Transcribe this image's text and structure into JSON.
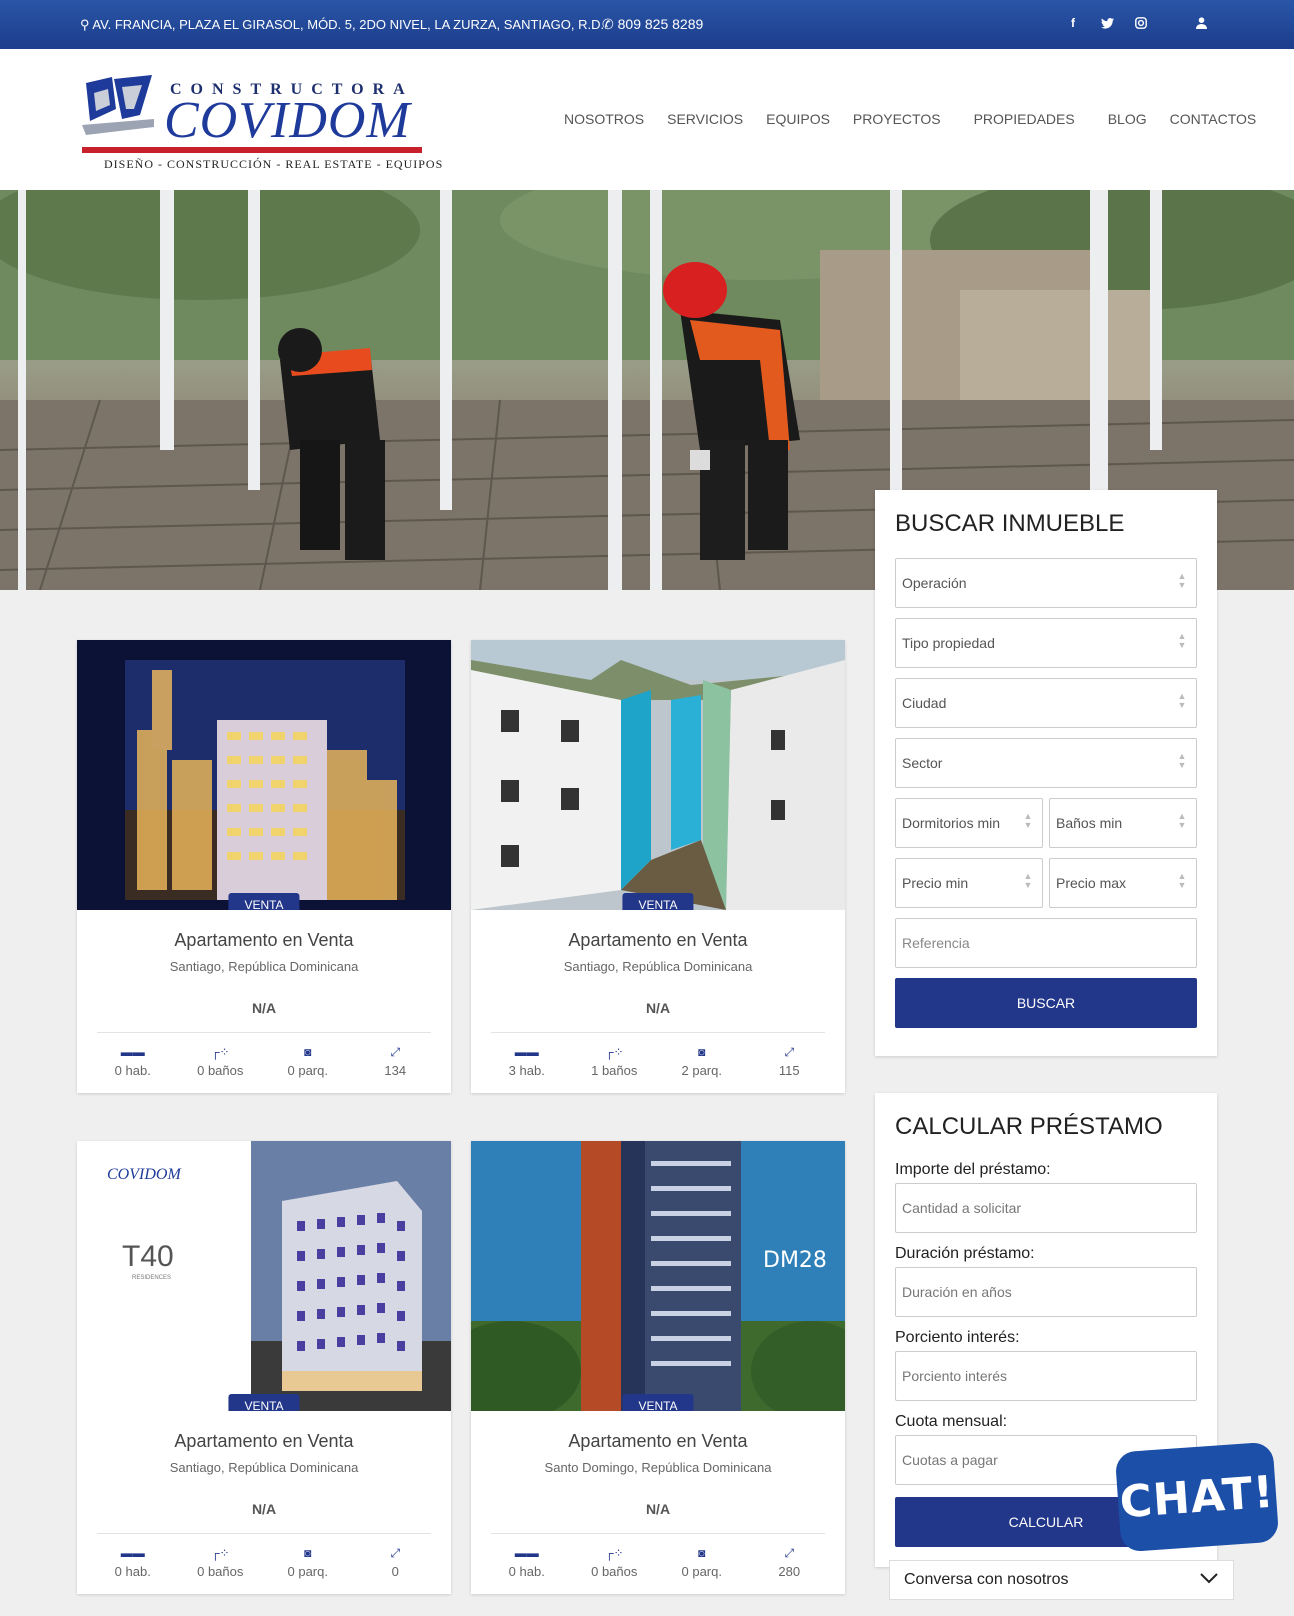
{
  "topbar": {
    "address": "AV. FRANCIA, PLAZA EL GIRASOL, MÓD. 5, 2DO NIVEL, LA ZURZA, SANTIAGO, R.D.",
    "phone": "809 825 8289",
    "social_icons": [
      "facebook-icon",
      "twitter-icon",
      "instagram-icon"
    ],
    "user_icon": "user-icon"
  },
  "brand": {
    "top_word": "CONSTRUCTORA",
    "name": "COVIDOM",
    "tagline": "DISEÑO - CONSTRUCCIÓN - REAL ESTATE - EQUIPOS",
    "color_primary": "#1e3a9a",
    "color_accent": "#c8202a"
  },
  "nav": {
    "items": [
      "NOSOTROS",
      "SERVICIOS",
      "EQUIPOS",
      "PROYECTOS",
      "PROPIEDADES",
      "BLOG",
      "CONTACTOS"
    ]
  },
  "listings": [
    {
      "badge": "VENTA",
      "title": "Apartamento en Venta",
      "location": "Santiago, República Dominicana",
      "price": "N/A",
      "beds": "0 hab.",
      "baths": "0 baños",
      "parking": "0 parq.",
      "area": "134"
    },
    {
      "badge": "VENTA",
      "title": "Apartamento en Venta",
      "location": "Santiago, República Dominicana",
      "price": "N/A",
      "beds": "3 hab.",
      "baths": "1 baños",
      "parking": "2 parq.",
      "area": "115"
    },
    {
      "badge": "VENTA",
      "title": "Apartamento en Venta",
      "location": "Santiago, República Dominicana",
      "price": "N/A",
      "beds": "0 hab.",
      "baths": "0 baños",
      "parking": "0 parq.",
      "area": "0",
      "image_text": "T40",
      "image_subtext": "RESIDENCES",
      "image_logo": "COVIDOM"
    },
    {
      "badge": "VENTA",
      "title": "Apartamento en Venta",
      "location": "Santo Domingo, República Dominicana",
      "price": "N/A",
      "beds": "0 hab.",
      "baths": "0 baños",
      "parking": "0 parq.",
      "area": "280",
      "image_text": "DM28"
    }
  ],
  "search": {
    "title": "BUSCAR INMUEBLE",
    "operation": "Operación",
    "property_type": "Tipo propiedad",
    "city": "Ciudad",
    "sector": "Sector",
    "beds_min": "Dormitorios min",
    "baths_min": "Baños min",
    "price_min": "Precio min",
    "price_max": "Precio max",
    "reference_placeholder": "Referencia",
    "button": "BUSCAR"
  },
  "loan": {
    "title": "CALCULAR PRÉSTAMO",
    "amount_label": "Importe del préstamo:",
    "amount_placeholder": "Cantidad a solicitar",
    "duration_label": "Duración préstamo:",
    "duration_placeholder": "Duración en años",
    "interest_label": "Porciento interés:",
    "interest_placeholder": "Porciento interés",
    "fee_label": "Cuota mensual:",
    "fee_placeholder": "Cuotas a pagar",
    "button": "CALCULAR"
  },
  "chat": {
    "bubble": "CHAT!",
    "bar_label": "Conversa con nosotros"
  }
}
